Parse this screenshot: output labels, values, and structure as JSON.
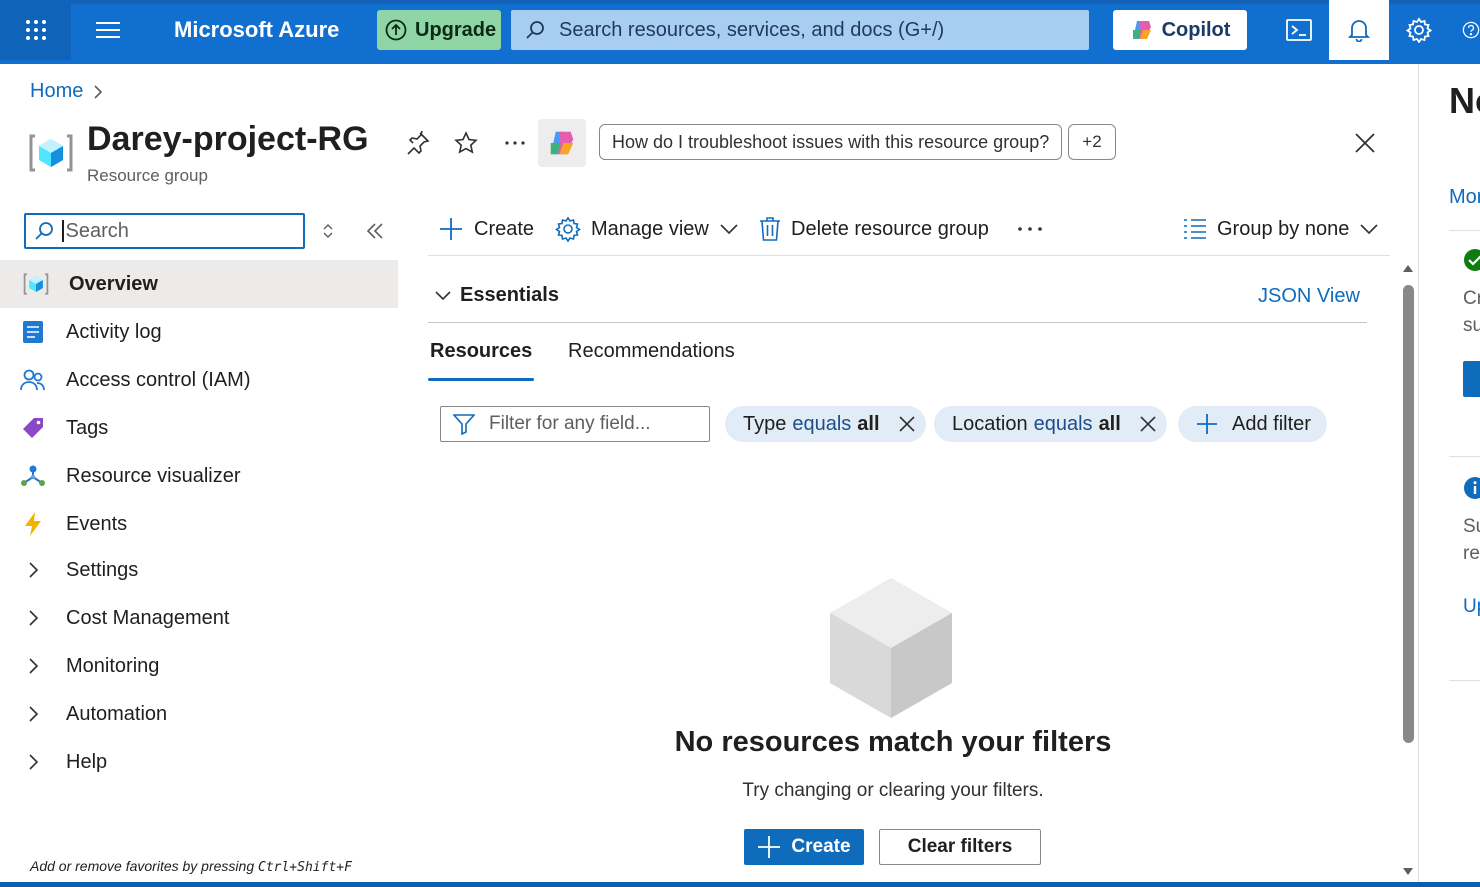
{
  "topbar": {
    "brand": "Microsoft Azure",
    "upgrade_label": "Upgrade",
    "search_placeholder": "Search resources, services, and docs (G+/)",
    "copilot_label": "Copilot",
    "icons": [
      "waffle-icon",
      "hamburger-icon",
      "cloud-shell-icon",
      "bell-icon",
      "gear-icon",
      "help-icon"
    ]
  },
  "breadcrumb": {
    "home": "Home"
  },
  "header": {
    "title": "Darey-project-RG",
    "subtitle": "Resource group",
    "copilot_prompt": "How do I troubleshoot issues with this resource group?",
    "more_prompts": "+2"
  },
  "nav": {
    "search_placeholder": "Search",
    "items": [
      {
        "label": "Overview",
        "icon": "resource-group-icon",
        "selected": true
      },
      {
        "label": "Activity log",
        "icon": "activity-log-icon"
      },
      {
        "label": "Access control (IAM)",
        "icon": "iam-icon"
      },
      {
        "label": "Tags",
        "icon": "tag-icon"
      },
      {
        "label": "Resource visualizer",
        "icon": "visualizer-icon"
      },
      {
        "label": "Events",
        "icon": "lightning-icon"
      },
      {
        "label": "Settings",
        "icon": "chevron-right-icon"
      },
      {
        "label": "Cost Management",
        "icon": "chevron-right-icon"
      },
      {
        "label": "Monitoring",
        "icon": "chevron-right-icon"
      },
      {
        "label": "Automation",
        "icon": "chevron-right-icon"
      },
      {
        "label": "Help",
        "icon": "chevron-right-icon"
      }
    ],
    "footer_prefix": "Add or remove favorites by pressing ",
    "footer_shortcut": "Ctrl+Shift+F"
  },
  "commands": {
    "create": "Create",
    "manage_view": "Manage view",
    "delete": "Delete resource group",
    "group_by": "Group by none"
  },
  "essentials": {
    "label": "Essentials",
    "json_view": "JSON View"
  },
  "tabs": {
    "resources": "Resources",
    "recommendations": "Recommendations"
  },
  "filters": {
    "placeholder": "Filter for any field...",
    "type_pill": {
      "field": "Type",
      "op": "equals",
      "value": "all"
    },
    "location_pill": {
      "field": "Location",
      "op": "equals",
      "value": "all"
    },
    "add_filter": "Add filter"
  },
  "empty_state": {
    "title": "No resources match your filters",
    "subtitle": "Try changing or clearing your filters.",
    "create_label": "Create",
    "clear_label": "Clear filters"
  },
  "right_panel": {
    "title": "No",
    "more": "Mor",
    "line1a": "Cr",
    "line1b": "su",
    "line2a": "Su",
    "line2b": "re",
    "link": "Up"
  },
  "colors": {
    "azure_blue": "#1170cf",
    "link": "#0f6cbd",
    "upgrade_green": "#8fd5a6"
  }
}
